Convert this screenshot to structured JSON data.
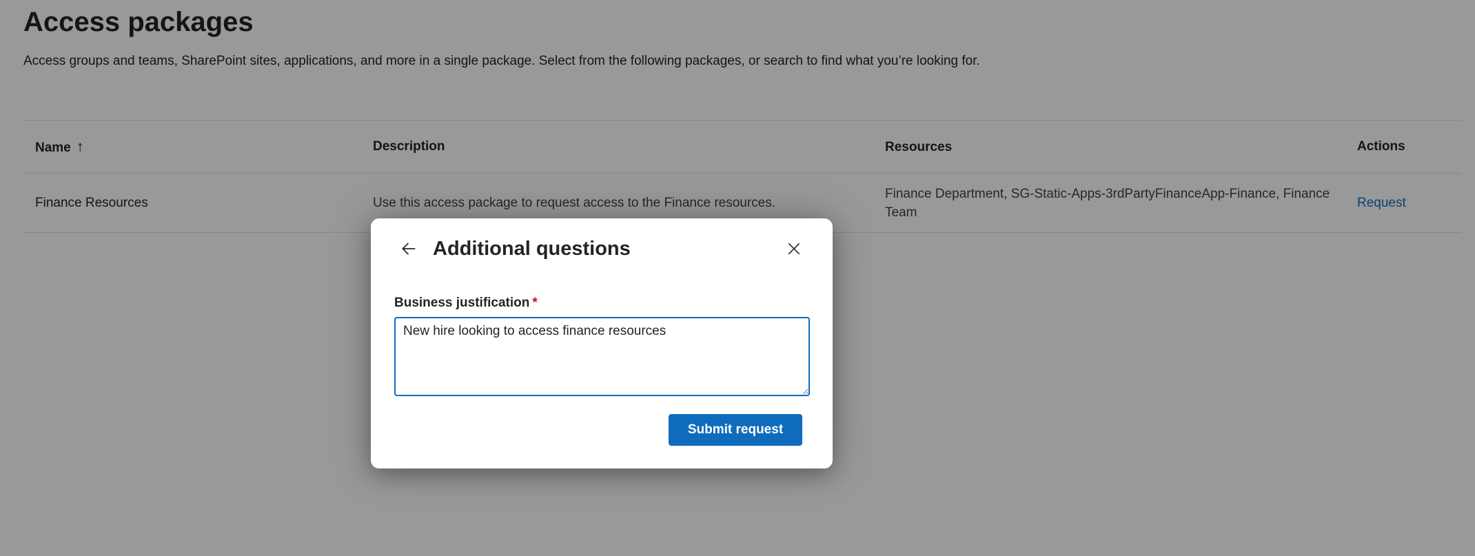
{
  "page": {
    "title": "Access packages",
    "subtitle": "Access groups and teams, SharePoint sites, applications, and more in a single package. Select from the following packages, or search to find what you’re looking for."
  },
  "table": {
    "columns": {
      "name": "Name",
      "name_sort_icon": "arrow-up-icon",
      "sort_glyph": "↑",
      "description": "Description",
      "resources": "Resources",
      "actions": "Actions"
    },
    "rows": [
      {
        "name": "Finance Resources",
        "description": "Use this access package to request access to the Finance resources.",
        "resources": "Finance Department, SG-Static-Apps-3rdPartyFinanceApp-Finance, Finance Team",
        "action": "Request"
      }
    ]
  },
  "dialog": {
    "title": "Additional questions",
    "back_icon": "arrow-left-icon",
    "close_icon": "close-icon",
    "field_label": "Business justification",
    "required_marker": "*",
    "field_value": "New hire looking to access finance resources",
    "submit_label": "Submit request"
  },
  "colors": {
    "accent": "#0f6cbd",
    "required": "#c50f1f",
    "overlay": "rgba(0,0,0,0.40)"
  }
}
